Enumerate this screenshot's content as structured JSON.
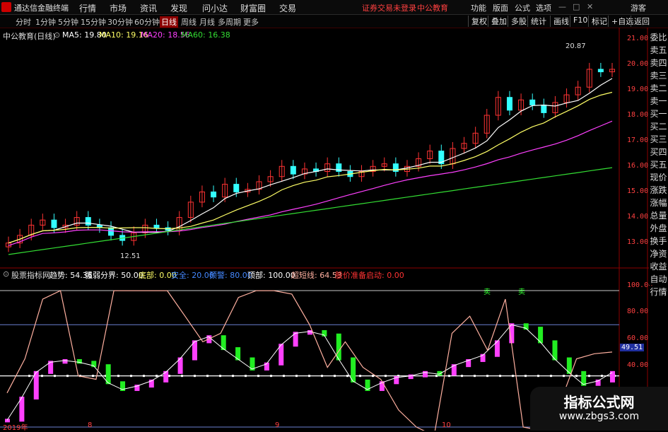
{
  "app": {
    "title": "通达信金融终端"
  },
  "menu": {
    "items": [
      "行情",
      "市场",
      "资讯",
      "发现",
      "问小达",
      "财富圈",
      "交易"
    ],
    "notice": "证券交易未登录",
    "stock_notice": "中公教育",
    "right": [
      "功能",
      "版面",
      "公式",
      "选项"
    ],
    "guest": "游客"
  },
  "toolbar": {
    "periods": [
      "分时",
      "1分钟",
      "5分钟",
      "15分钟",
      "30分钟",
      "60分钟",
      "日线",
      "周线",
      "月线",
      "多周期",
      "更多"
    ],
    "active": "日线",
    "right": [
      "复权",
      "叠加",
      "多股",
      "统计",
      "画线",
      "F10",
      "标记",
      "+自选",
      "返回"
    ]
  },
  "main_legend": {
    "stock": "中公教育(日线)",
    "ma": [
      {
        "label": "MA5: 19.80",
        "color": "#ffffff"
      },
      {
        "label": "MA10: 19.16",
        "color": "#ffff66"
      },
      {
        "label": "MA20: 18.56",
        "color": "#ff40ff"
      },
      {
        "label": "MA60: 16.38",
        "color": "#33dd33"
      }
    ]
  },
  "indicator_legend": {
    "name": "股票指标网",
    "items": [
      {
        "label": "趋势: 54.36",
        "color": "#ffffff"
      },
      {
        "label": "强弱分界: 50.00",
        "color": "#ffffff"
      },
      {
        "label": "底部: 0.00",
        "color": "#ffff66"
      },
      {
        "label": "安全: 20.00",
        "color": "#4488ff"
      },
      {
        "label": "预警: 80.00",
        "color": "#4488ff"
      },
      {
        "label": "顶部: 100.00",
        "color": "#ffffff"
      },
      {
        "label": "超短线: 64.53",
        "color": "#ffb0a0"
      },
      {
        "label": "股价准备启动: 0.00",
        "color": "#ff3333"
      }
    ]
  },
  "price_axis": [
    "21.00",
    "20.00",
    "19.00",
    "18.00",
    "17.00",
    "16.00",
    "15.00",
    "14.00",
    "13.00"
  ],
  "ind_axis": [
    "100.00",
    "80.00",
    "60.00",
    "49.51",
    "40.00"
  ],
  "annotations": {
    "high": "20.87",
    "low": "12.51",
    "sell": "卖"
  },
  "dates": [
    "2019年",
    "8",
    "9",
    "10"
  ],
  "sidebar": [
    "委比",
    "卖五",
    "卖四",
    "卖三",
    "卖二",
    "卖一",
    "买一",
    "买二",
    "买三",
    "买四",
    "买五",
    "现价",
    "涨跌",
    "涨幅",
    "总量",
    "外盘",
    "换手",
    "净资",
    "收益",
    "自动",
    "行情"
  ],
  "watermark": {
    "title": "指标公式网",
    "url": "www.zbgs3.com"
  },
  "colors": {
    "up": "#ff3333",
    "down": "#33ffff",
    "ma5": "#ffffff",
    "ma10": "#ffff66",
    "ma20": "#ff40ff",
    "ma60": "#33dd33",
    "trend_up": "#ff40ff",
    "trend_down": "#22ee22",
    "short": "#ffb0a0"
  },
  "chart_data": [
    {
      "type": "candlestick",
      "title": "中公教育(日线)",
      "close": [
        13.2,
        13.5,
        13.9,
        14.1,
        13.8,
        13.9,
        14.2,
        13.9,
        13.8,
        13.5,
        13.3,
        13.6,
        13.9,
        13.8,
        13.7,
        14.2,
        14.8,
        15.2,
        15.0,
        15.5,
        15.2,
        15.3,
        15.6,
        15.8,
        16.2,
        15.9,
        16.1,
        16.0,
        16.3,
        16.0,
        15.8,
        16.0,
        16.2,
        16.3,
        16.0,
        16.2,
        16.5,
        16.8,
        16.3,
        16.9,
        17.1,
        17.5,
        18.2,
        18.9,
        18.4,
        18.8,
        18.6,
        18.3,
        18.7,
        19.0,
        19.3,
        20.0,
        19.9,
        20.0
      ],
      "ylim": [
        12.5,
        21.3
      ]
    },
    {
      "type": "line",
      "title": "股票指标网",
      "ylim": [
        20,
        105
      ],
      "series": [
        {
          "name": "趋势",
          "values": [
            24,
            37,
            52,
            58,
            59,
            58,
            56,
            46,
            42,
            44,
            47,
            52,
            60,
            70,
            73,
            66,
            60,
            54,
            57,
            68,
            75,
            76,
            74,
            60,
            47,
            42,
            46,
            49,
            50,
            52,
            51,
            56,
            59,
            62,
            70,
            80,
            78,
            70,
            60,
            52,
            45,
            47,
            52
          ]
        },
        {
          "name": "超短线",
          "values": [
            40,
            60,
            95,
            100,
            50,
            48,
            100,
            100,
            100,
            100,
            85,
            70,
            75,
            96,
            100,
            100,
            98,
            80,
            55,
            70,
            55,
            48,
            30,
            20,
            15,
            75,
            85,
            65,
            95,
            20,
            18,
            32,
            60,
            63,
            64
          ]
        }
      ]
    }
  ]
}
